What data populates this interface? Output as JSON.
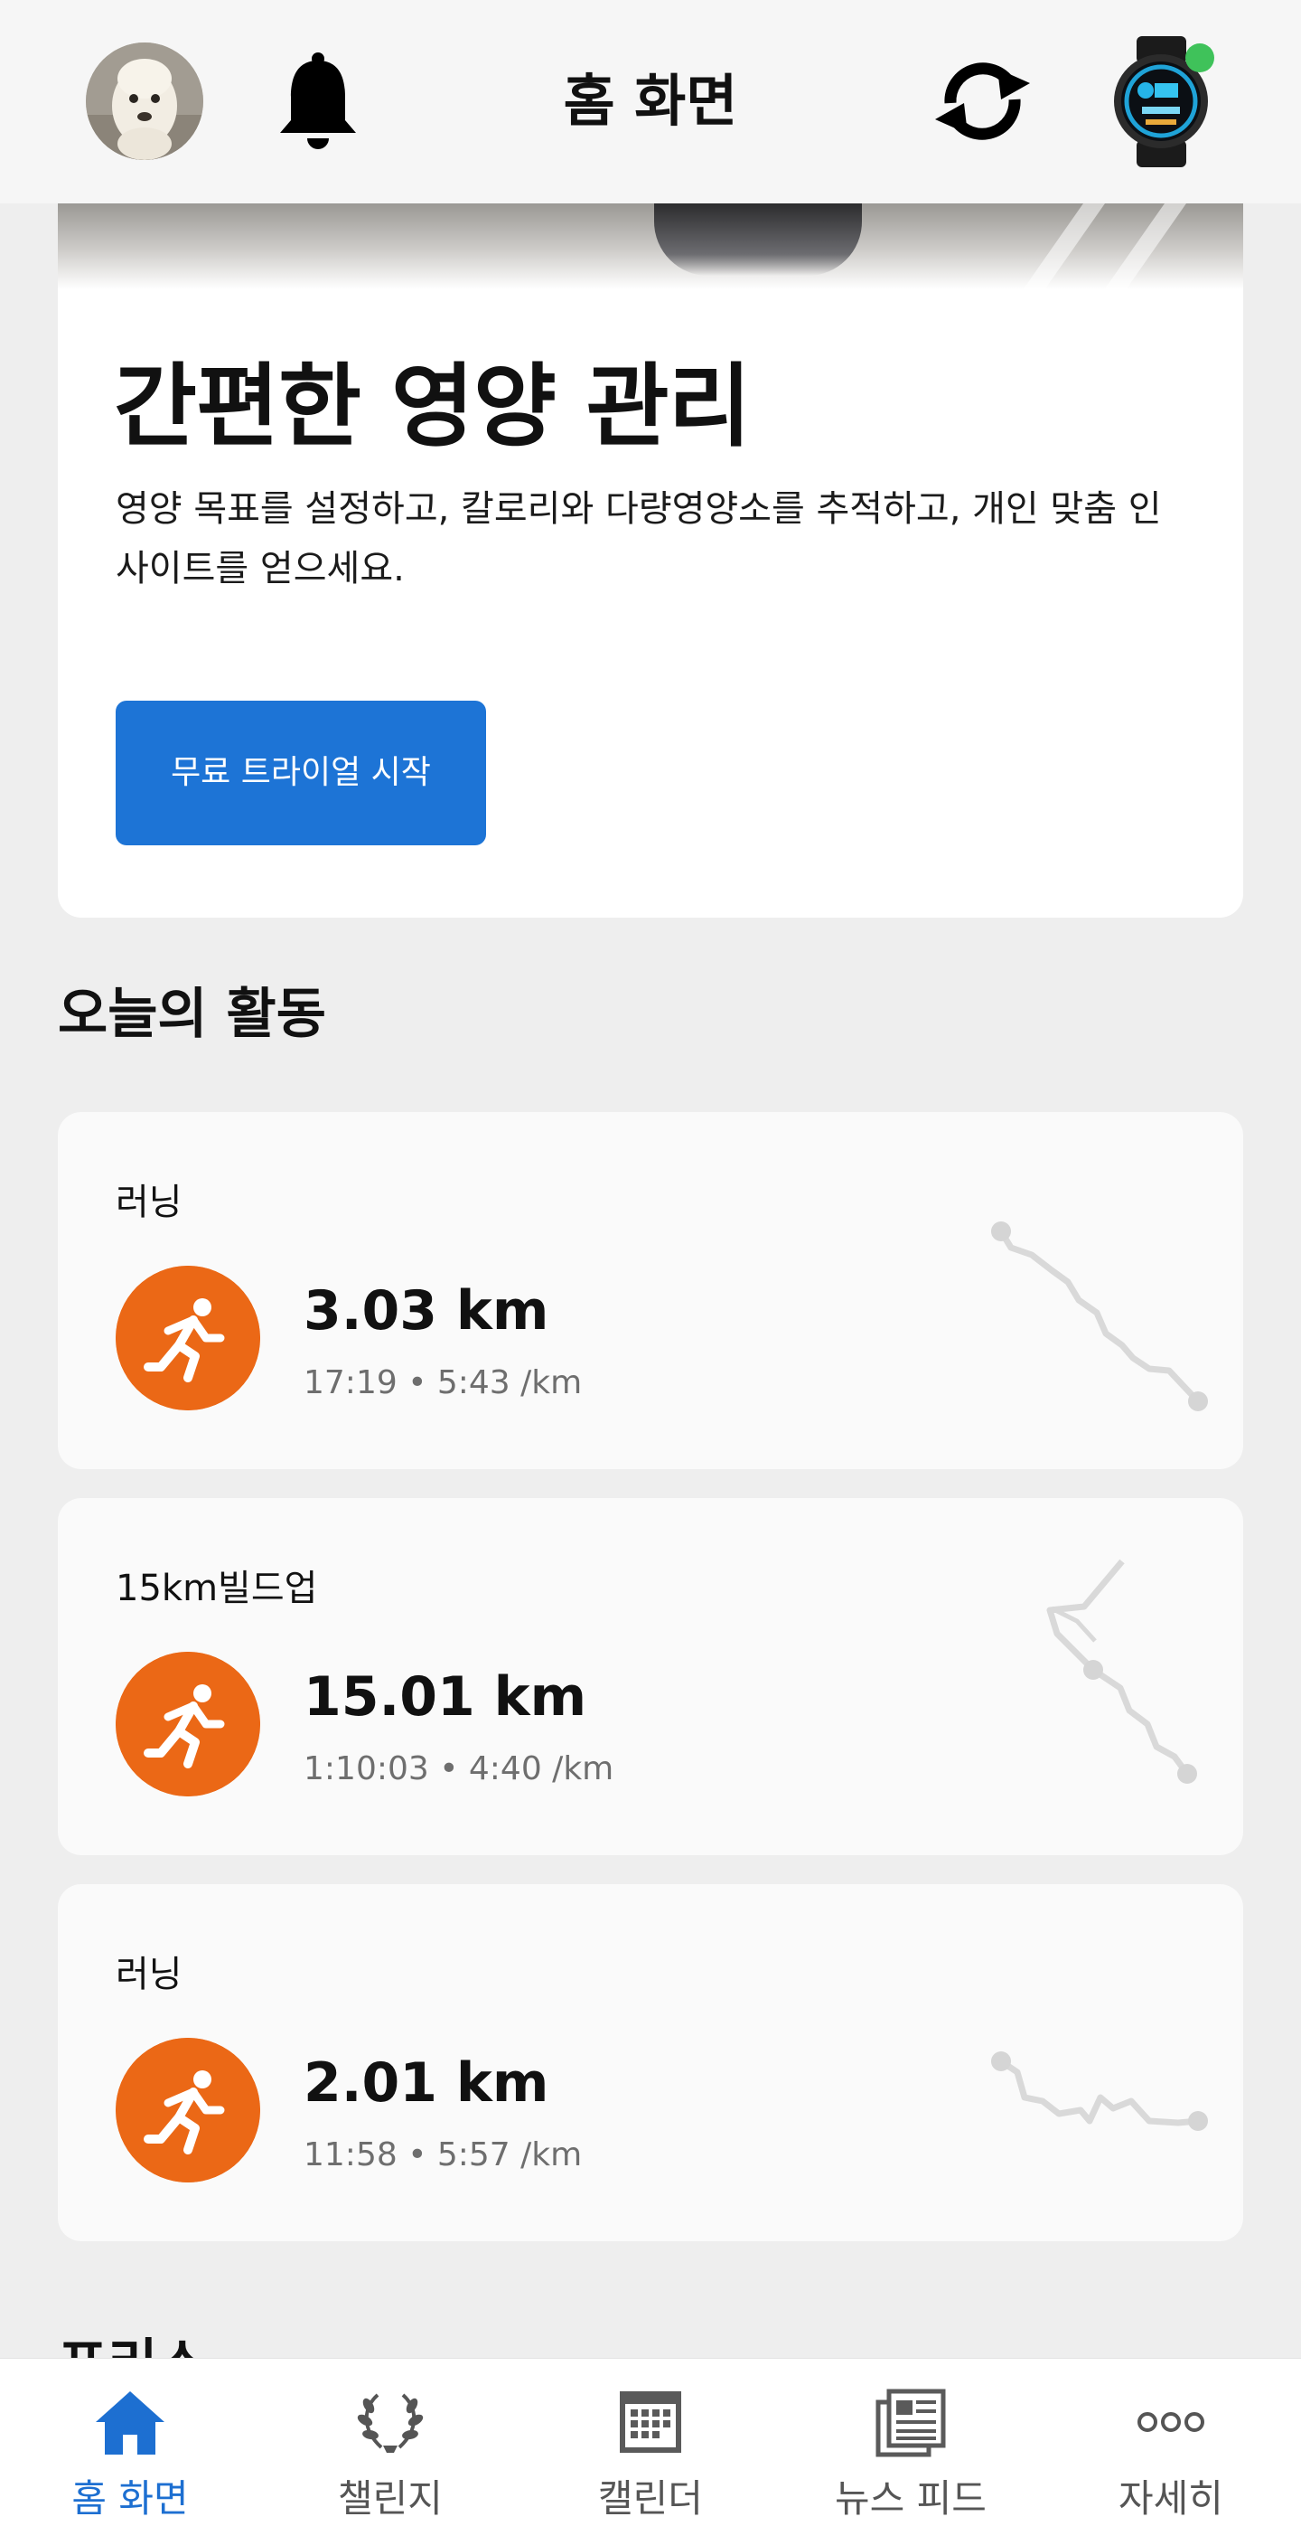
{
  "header": {
    "title": "홈 화면",
    "avatar_icon": "alpaca-profile-photo",
    "notification_icon": "bell-icon",
    "sync_icon": "sync-icon",
    "device_icon": "smartwatch-icon",
    "device_status_color": "#3fc25a"
  },
  "promo": {
    "title": "간편한 영양 관리",
    "description": "영양 목표를 설정하고, 칼로리와 다량영양소를 추적하고, 개인 맞춤 인사이트를 얻으세요.",
    "button_label": "무료 트라이얼 시작",
    "button_color": "#1d74d6"
  },
  "activities_section": {
    "title": "오늘의 활동",
    "icon_color": "#eb6816",
    "items": [
      {
        "name": "러닝",
        "distance": "3.03 km",
        "stats": "17:19 • 5:43 /km"
      },
      {
        "name": "15km빌드업",
        "distance": "15.01 km",
        "stats": "1:10:03 • 4:40 /km"
      },
      {
        "name": "러닝",
        "distance": "2.01 km",
        "stats": "11:58 • 5:57 /km"
      }
    ]
  },
  "next_section": {
    "title": "프리스"
  },
  "bottom_nav": {
    "active_color": "#1d6fd1",
    "items": [
      {
        "label": "홈 화면",
        "icon": "home-icon",
        "active": true
      },
      {
        "label": "챌린지",
        "icon": "laurel-icon",
        "active": false
      },
      {
        "label": "캘린더",
        "icon": "calendar-icon",
        "active": false
      },
      {
        "label": "뉴스 피드",
        "icon": "newspaper-icon",
        "active": false
      },
      {
        "label": "자세히",
        "icon": "more-icon",
        "active": false
      }
    ]
  }
}
